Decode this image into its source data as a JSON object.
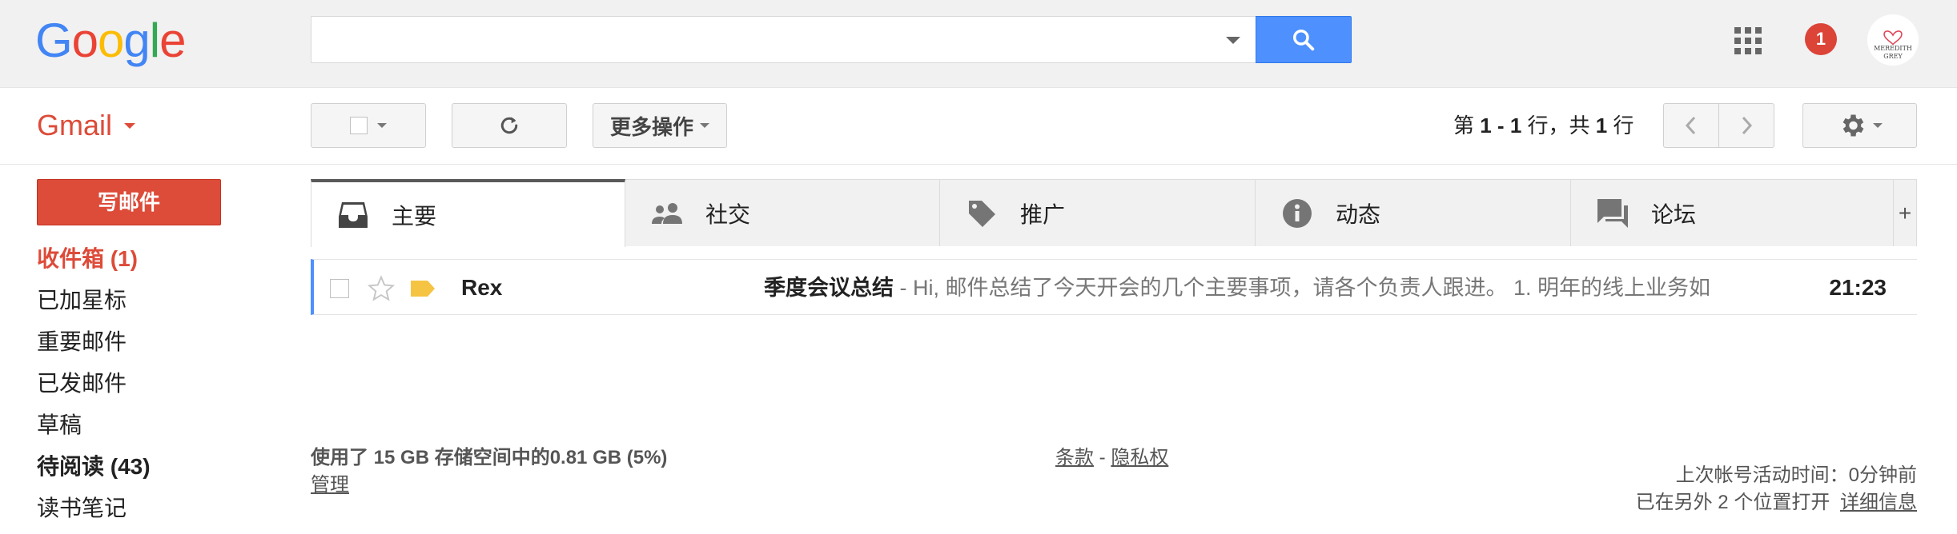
{
  "header": {
    "logo_letters": [
      {
        "char": "G",
        "color": "#4285f4"
      },
      {
        "char": "o",
        "color": "#ea4335"
      },
      {
        "char": "o",
        "color": "#fbbc05"
      },
      {
        "char": "g",
        "color": "#4285f4"
      },
      {
        "char": "l",
        "color": "#34a853"
      },
      {
        "char": "e",
        "color": "#ea4335"
      }
    ],
    "search": {
      "value": "",
      "placeholder": ""
    },
    "notification_count": "1",
    "avatar": {
      "line1": "MEREDITH",
      "line2": "GREY"
    }
  },
  "toolbar": {
    "app_label": "Gmail",
    "more_actions": "更多操作",
    "pager": {
      "prefix": "第",
      "range": "1 - 1",
      "mid": "行，共",
      "total": "1",
      "suffix": "行"
    }
  },
  "sidebar": {
    "compose": "写邮件",
    "items": [
      {
        "label": "收件箱 (1)",
        "state": "active"
      },
      {
        "label": "已加星标",
        "state": "normal"
      },
      {
        "label": "重要邮件",
        "state": "normal"
      },
      {
        "label": "已发邮件",
        "state": "normal"
      },
      {
        "label": "草稿",
        "state": "normal"
      },
      {
        "label": "待阅读 (43)",
        "state": "bold"
      },
      {
        "label": "读书笔记",
        "state": "normal"
      }
    ]
  },
  "tabs": [
    {
      "label": "主要",
      "icon": "inbox-icon",
      "active": true
    },
    {
      "label": "社交",
      "icon": "people-icon",
      "active": false
    },
    {
      "label": "推广",
      "icon": "tag-icon",
      "active": false
    },
    {
      "label": "动态",
      "icon": "info-icon",
      "active": false
    },
    {
      "label": "论坛",
      "icon": "forum-icon",
      "active": false
    }
  ],
  "tab_add": "+",
  "messages": [
    {
      "sender": "Rex",
      "subject": "季度会议总结",
      "snippet": " - Hi,   邮件总结了今天开会的几个主要事项，请各个负责人跟进。 1. 明年的线上业务如",
      "time": "21:23",
      "label_color": "#f6c443"
    }
  ],
  "footer": {
    "storage": "使用了 15 GB 存储空间中的0.81 GB (5%)",
    "manage": "管理",
    "terms": "条款",
    "sep": " - ",
    "privacy": "隐私权",
    "last_activity": "上次帐号活动时间：0分钟前",
    "open_elsewhere": "已在另外 2 个位置打开",
    "details": "详细信息"
  },
  "colors": {
    "accent_red": "#dd4b39",
    "search_blue": "#4d90fe",
    "badge_red": "#db4437"
  }
}
